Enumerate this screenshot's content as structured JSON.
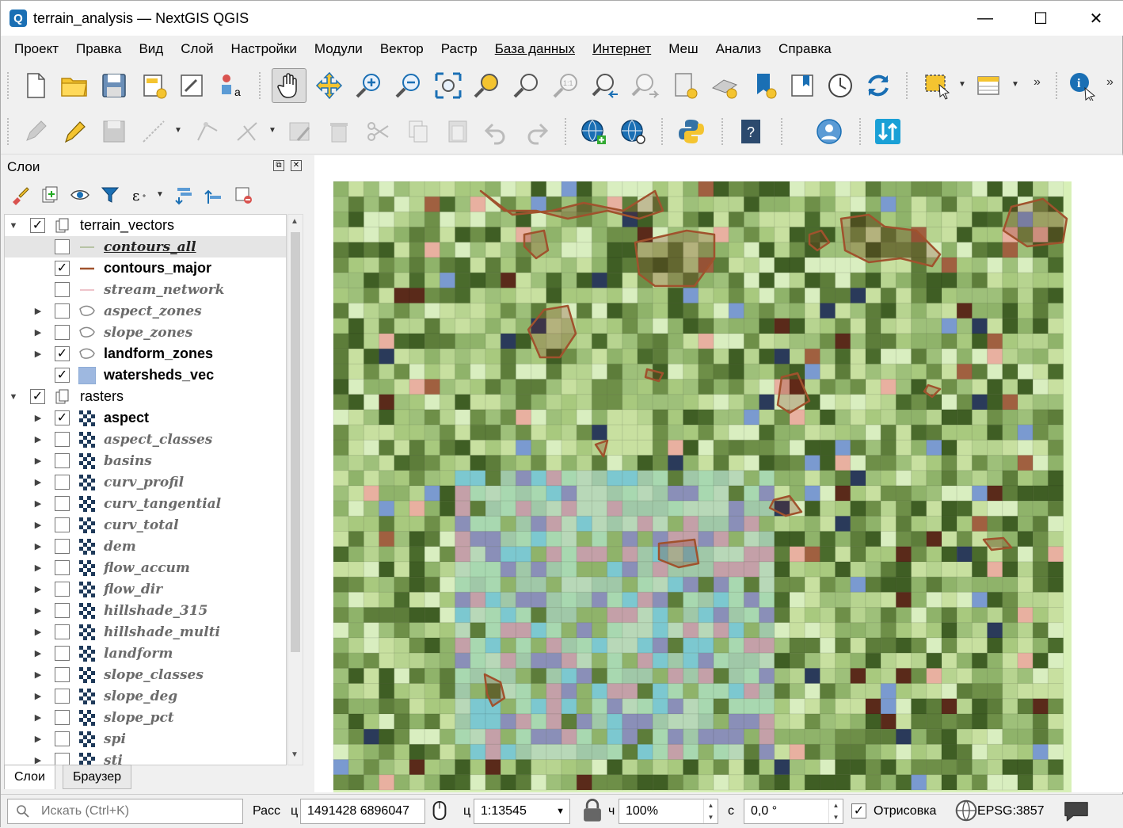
{
  "window": {
    "title": "terrain_analysis — NextGIS QGIS",
    "app_icon_letter": "Q",
    "minimize": "—",
    "maximize": "☐",
    "close": "✕"
  },
  "menu": [
    "Проект",
    "Правка",
    "Вид",
    "Слой",
    "Настройки",
    "Модули",
    "Вектор",
    "Растр",
    "База данных",
    "Интернет",
    "Меш",
    "Анализ",
    "Справка"
  ],
  "toolbar": {
    "overflow": "»",
    "overflow2": "»"
  },
  "layers_panel": {
    "title": "Слои",
    "float_btn": "⧉",
    "close_btn": "✕",
    "groups": [
      {
        "name": "terrain_vectors",
        "checked": true,
        "layers": [
          {
            "name": "contours_all",
            "checked": false,
            "style": "off underline",
            "icon": "line-icon-olive"
          },
          {
            "name": "contours_major",
            "checked": true,
            "style": "on",
            "icon": "line-icon-brown"
          },
          {
            "name": "stream_network",
            "checked": false,
            "style": "off",
            "icon": "line-icon-pink"
          },
          {
            "name": "aspect_zones",
            "checked": false,
            "style": "off",
            "icon": "polygon-icon"
          },
          {
            "name": "slope_zones",
            "checked": false,
            "style": "off",
            "icon": "polygon-icon"
          },
          {
            "name": "landform_zones",
            "checked": true,
            "style": "on",
            "icon": "polygon-icon"
          },
          {
            "name": "watersheds_vec",
            "checked": true,
            "style": "on",
            "icon": "fill-icon-blue"
          }
        ]
      },
      {
        "name": "rasters",
        "checked": true,
        "layers": [
          {
            "name": "aspect",
            "checked": true,
            "style": "on",
            "icon": "raster-icon"
          },
          {
            "name": "aspect_classes",
            "checked": false,
            "style": "off",
            "icon": "raster-icon"
          },
          {
            "name": "basins",
            "checked": false,
            "style": "off",
            "icon": "raster-icon"
          },
          {
            "name": "curv_profil",
            "checked": false,
            "style": "off",
            "icon": "raster-icon"
          },
          {
            "name": "curv_tangential",
            "checked": false,
            "style": "off",
            "icon": "raster-icon"
          },
          {
            "name": "curv_total",
            "checked": false,
            "style": "off",
            "icon": "raster-icon"
          },
          {
            "name": "dem",
            "checked": false,
            "style": "off",
            "icon": "raster-icon"
          },
          {
            "name": "flow_accum",
            "checked": false,
            "style": "off",
            "icon": "raster-icon"
          },
          {
            "name": "flow_dir",
            "checked": false,
            "style": "off",
            "icon": "raster-icon"
          },
          {
            "name": "hillshade_315",
            "checked": false,
            "style": "off",
            "icon": "raster-icon"
          },
          {
            "name": "hillshade_multi",
            "checked": false,
            "style": "off",
            "icon": "raster-icon"
          },
          {
            "name": "landform",
            "checked": false,
            "style": "off",
            "icon": "raster-icon"
          },
          {
            "name": "slope_classes",
            "checked": false,
            "style": "off",
            "icon": "raster-icon"
          },
          {
            "name": "slope_deg",
            "checked": false,
            "style": "off",
            "icon": "raster-icon"
          },
          {
            "name": "slope_pct",
            "checked": false,
            "style": "off",
            "icon": "raster-icon"
          },
          {
            "name": "spi",
            "checked": false,
            "style": "off",
            "icon": "raster-icon"
          },
          {
            "name": "sti",
            "checked": false,
            "style": "off",
            "icon": "raster-icon"
          }
        ]
      }
    ],
    "tabs": [
      "Слои",
      "Браузер"
    ]
  },
  "statusbar": {
    "search_placeholder": "Искать (Ctrl+K)",
    "coord_label": "Расс",
    "coord_prefix": "ц",
    "coordinates": "1491428  6896047",
    "scale_label": "ц",
    "scale": "1:13545",
    "magnifier_label": "ч",
    "magnifier": "100%",
    "rotation_label": "с",
    "rotation": "0,0 °",
    "render_label": "Отрисовка",
    "render_checked": true,
    "crs": "EPSG:3857"
  },
  "colors": {
    "accent": "#1a6fb4",
    "contour": "#a0522d",
    "map_bg": "#d8f0b8"
  }
}
